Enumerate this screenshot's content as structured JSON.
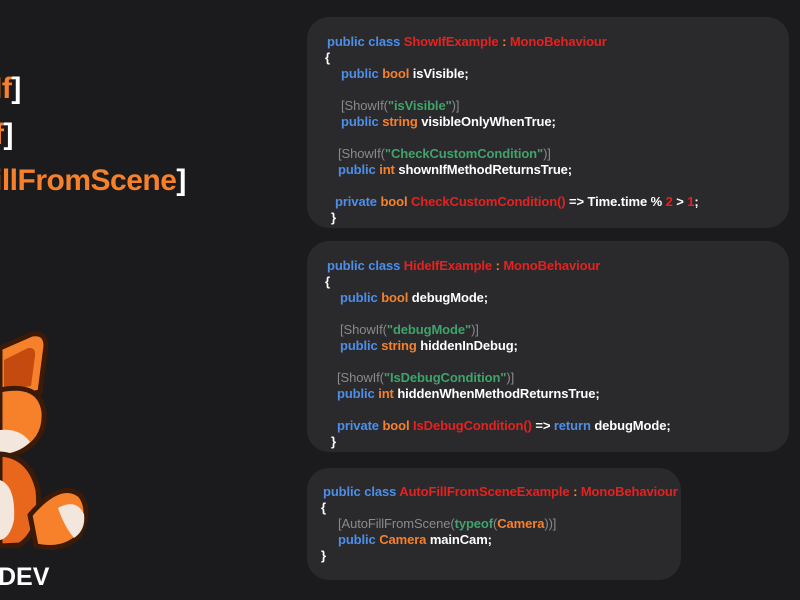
{
  "titles": [
    {
      "name": "If",
      "open": "",
      "close": "]"
    },
    {
      "name": "f",
      "open": "",
      "close": "]"
    },
    {
      "name": "illFromScene",
      "open": "",
      "close": "]"
    }
  ],
  "brand": "DEV",
  "cards": {
    "showif": {
      "l1": {
        "kw1": "public",
        "kw2": "class",
        "name": "ShowIfExample",
        "colon": ":",
        "base": "MonoBehaviour"
      },
      "l2": "{",
      "l3": {
        "kw1": "public",
        "kw2": "bool",
        "rest": "isVisible;"
      },
      "l4": {
        "open": "[ShowIf(",
        "str": "\"isVisible\"",
        "close": ")]"
      },
      "l5": {
        "kw1": "public",
        "kw2": "string",
        "rest": "visibleOnlyWhenTrue;"
      },
      "l6": {
        "open": "[ShowIf(",
        "str": "\"CheckCustomCondition\"",
        "close": ")]"
      },
      "l7": {
        "kw1": "public",
        "kw2": "int",
        "rest": "shownIfMethodReturnsTrue;"
      },
      "l8": {
        "kw1": "private",
        "kw2": "bool",
        "method": "CheckCustomCondition()",
        "arrow": "=>",
        "expr": "Time.time",
        "op1": "%",
        "n1": "2",
        "op2": ">",
        "n2": "1",
        "end": ";"
      },
      "l9": "}"
    },
    "hideif": {
      "l1": {
        "kw1": "public",
        "kw2": "class",
        "name": "HideIfExample",
        "colon": ":",
        "base": "MonoBehaviour"
      },
      "l2": "{",
      "l3": {
        "kw1": "public",
        "kw2": "bool",
        "rest": "debugMode;"
      },
      "l4": {
        "open": "[ShowIf(",
        "str": "\"debugMode\"",
        "close": ")]"
      },
      "l5": {
        "kw1": "public",
        "kw2": "string",
        "rest": "hiddenInDebug;"
      },
      "l6": {
        "open": "[ShowIf(",
        "str": "\"IsDebugCondition\"",
        "close": ")]"
      },
      "l7": {
        "kw1": "public",
        "kw2": "int",
        "rest": "hiddenWhenMethodReturnsTrue;"
      },
      "l8": {
        "kw1": "private",
        "kw2": "bool",
        "method": "IsDebugCondition()",
        "arrow": "=>",
        "kw3": "return",
        "rest": "debugMode;"
      },
      "l9": "}"
    },
    "autofill": {
      "l1": {
        "kw1": "public",
        "kw2": "class",
        "name": "AutoFillFromSceneExample",
        "colon": ":",
        "base": "MonoBehaviour"
      },
      "l2": "{",
      "l3": {
        "open": "[AutoFillFromScene(",
        "kw": "typeof",
        "p1": "(",
        "type": "Camera",
        "p2": "))]"
      },
      "l4": {
        "kw1": "public",
        "type": "Camera",
        "rest": "mainCam;"
      },
      "l5": "}"
    }
  },
  "colors": {
    "keyword": "#4d8ee9",
    "type": "#e8201e",
    "string": "#3fa36b",
    "attribute": "#8a8a8a",
    "accent": "#f7812a",
    "card": "#2a2a2d",
    "background": "#1b1a1d"
  },
  "icons": {
    "mascot": "fox-mascot-icon"
  }
}
